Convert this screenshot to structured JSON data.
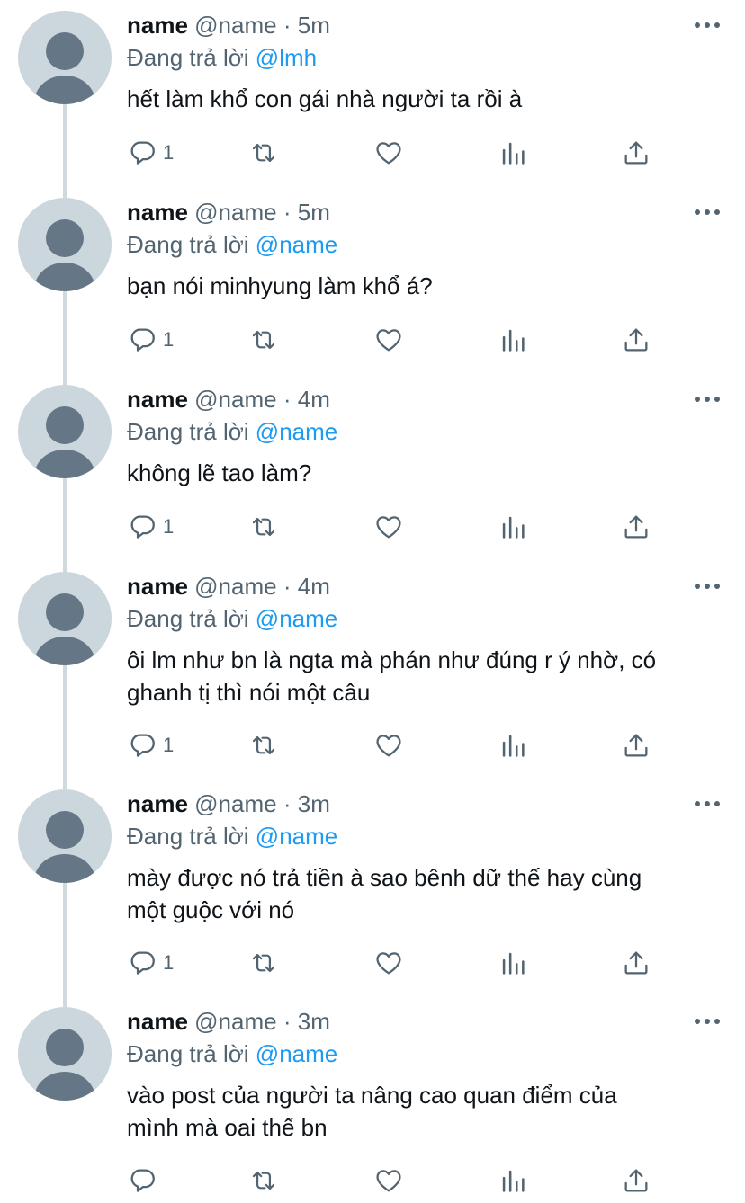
{
  "colors": {
    "text": "#0f1419",
    "secondary": "#536471",
    "link": "#1d9bf0",
    "avatar_bg": "#ccd6dd",
    "avatar_fg": "#657786",
    "thread_line": "#cfd9de"
  },
  "tweets": [
    {
      "name": "name",
      "handle": "@name",
      "sep": "·",
      "time": "5m",
      "replying_prefix": "Đang trả lời",
      "replying_handle": "@lmh",
      "lines": [
        "hết làm khổ con gái nhà người ta rồi à"
      ],
      "reply_count": "1"
    },
    {
      "name": "name",
      "handle": "@name",
      "sep": "·",
      "time": "5m",
      "replying_prefix": "Đang trả lời",
      "replying_handle": "@name",
      "lines": [
        "bạn nói minhyung làm khổ á?"
      ],
      "reply_count": "1"
    },
    {
      "name": "name",
      "handle": "@name",
      "sep": "·",
      "time": "4m",
      "replying_prefix": "Đang trả lời",
      "replying_handle": "@name",
      "lines": [
        "không lẽ tao làm?"
      ],
      "reply_count": "1"
    },
    {
      "name": "name",
      "handle": "@name",
      "sep": "·",
      "time": "4m",
      "replying_prefix": "Đang trả lời",
      "replying_handle": "@name",
      "lines": [
        "ôi lm như bn là ngta mà phán như đúng r ý nhờ, có",
        "ghanh tị thì nói một câu"
      ],
      "reply_count": "1"
    },
    {
      "name": "name",
      "handle": "@name",
      "sep": "·",
      "time": "3m",
      "replying_prefix": "Đang trả lời",
      "replying_handle": "@name",
      "lines": [
        "mày được nó trả tiền à sao bênh dữ thế hay cùng",
        "một guộc với nó"
      ],
      "reply_count": "1"
    },
    {
      "name": "name",
      "handle": "@name",
      "sep": "·",
      "time": "3m",
      "replying_prefix": "Đang trả lời",
      "replying_handle": "@name",
      "lines": [
        "vào post của người ta nâng cao quan điểm của",
        "mình mà oai thế bn"
      ],
      "reply_count": ""
    }
  ]
}
